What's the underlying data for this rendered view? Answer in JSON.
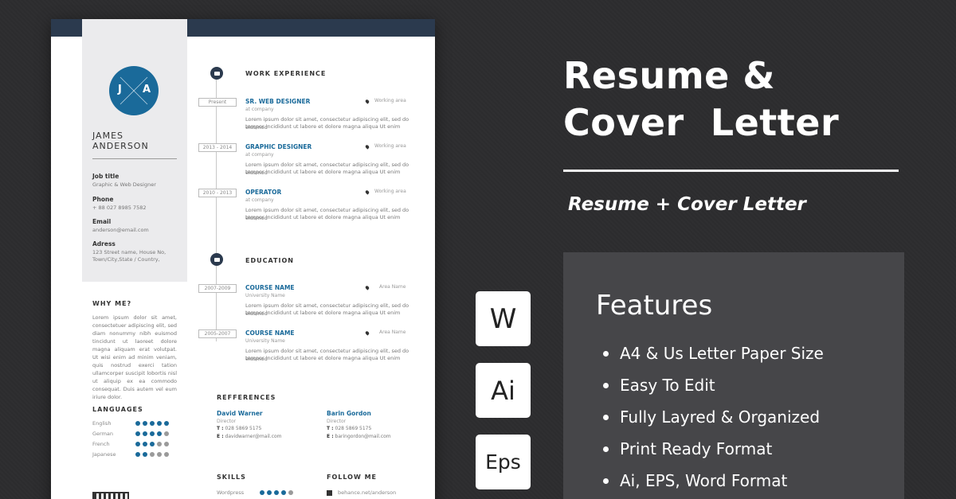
{
  "resume": {
    "initials": [
      "J",
      "A"
    ],
    "name_line1": "JAMES",
    "name_line2": "ANDERSON",
    "sidebar": [
      {
        "label": "Job title",
        "value": [
          "Graphic & Web Designer"
        ]
      },
      {
        "label": "Phone",
        "value": [
          "+ 88 027 8985 7582"
        ]
      },
      {
        "label": "Email",
        "value": [
          "anderson@email.com"
        ]
      },
      {
        "label": "Adress",
        "value": [
          "123 Street name, House No,",
          "Town/City,State / Country,"
        ]
      }
    ],
    "why_title": "WHY ME?",
    "why_text": "Lorem ipsum dolor sit amet, consectetuer adipiscing elit, sed diam nonummy nibh euismod tincidunt ut laoreet dolore magna aliquam erat volutpat. Ut wisi enim ad minim veniam, quis nostrud exerci tation ullamcorper suscipit lobortis nisl ut aliquip ex ea commodo consequat. Duis autem vel eum iriure dolor.",
    "languages_title": "LANGUAGES",
    "languages": [
      {
        "name": "English",
        "level": 5
      },
      {
        "name": "German",
        "level": 4
      },
      {
        "name": "French",
        "level": 3
      },
      {
        "name": "Japanese",
        "level": 2
      }
    ],
    "work_title": "WORK EXPERIENCE",
    "jobs": [
      {
        "date": "Present",
        "title": "SR. WEB DESIGNER",
        "company": "at company",
        "location": "Working area",
        "desc": [
          "Lorem ipsum dolor sit amet, consectetur adipiscing elit, sed do eiusmod",
          "tempor incididunt ut labore et dolore magna aliqua Ut enim"
        ]
      },
      {
        "date": "2013 - 2014",
        "title": "GRAPHIC DESIGNER",
        "company": "at company",
        "location": "Working area",
        "desc": [
          "Lorem ipsum dolor sit amet, consectetur adipiscing elit, sed do eiusmod",
          "tempor incididunt ut labore et dolore magna aliqua Ut enim"
        ]
      },
      {
        "date": "2010 - 2013",
        "title": "OPERATOR",
        "company": "at company",
        "location": "Working area",
        "desc": [
          "Lorem ipsum dolor sit amet, consectetur adipiscing elit, sed do eiusmod",
          "tempor incididunt ut labore et dolore magna aliqua Ut enim"
        ]
      }
    ],
    "education_title": "EDUCATION",
    "education": [
      {
        "date": "2007-2009",
        "title": "COURSE NAME",
        "school": "University Name",
        "location": "Area Name",
        "desc": [
          "Lorem ipsum dolor sit amet, consectetur adipiscing elit, sed do eiusmod",
          "tempor incididunt ut labore et dolore magna aliqua Ut enim"
        ]
      },
      {
        "date": "2005-2007",
        "title": "COURSE NAME",
        "school": "University Name",
        "location": "Area Name",
        "desc": [
          "Lorem ipsum dolor sit amet, consectetur adipiscing elit, sed do eiusmod",
          "tempor incididunt ut labore et dolore magna aliqua Ut enim"
        ]
      }
    ],
    "references_title": "REFFERENCES",
    "references": [
      {
        "name": "David Warner",
        "role": "Director",
        "t_label": "T :",
        "phone": "028 5869 5175",
        "e_label": "E :",
        "email": "davidwarner@mail.com"
      },
      {
        "name": "Barin Gordon",
        "role": "Director",
        "t_label": "T :",
        "phone": "028 5869 5175",
        "e_label": "E :",
        "email": "baringordon@mail.com"
      }
    ],
    "skills_title": "SKILLS",
    "skill": {
      "name": "Wordpress",
      "level": 4
    },
    "follow_title": "FOLLOW ME",
    "follow_text": "behance.net/anderson"
  },
  "badges": [
    "W",
    "Ai",
    "Eps"
  ],
  "headline": {
    "line1": "Resume &",
    "line2": "Cover  Letter"
  },
  "subhead": "Resume + Cover Letter",
  "features_title": "Features",
  "features": [
    "A4 & Us Letter Paper Size",
    "Easy To Edit",
    "Fully Layred & Organized",
    "Print Ready Format",
    "Ai, EPS, Word Format"
  ],
  "colors": {
    "accent": "#1a6a9a",
    "navy": "#2b3a4e",
    "background": "#2d2d2f",
    "features_box": "#464649"
  },
  "icons": [
    "briefcase-icon",
    "graduation-icon",
    "location-pin-icon",
    "behance-icon",
    "qr-code-icon"
  ]
}
